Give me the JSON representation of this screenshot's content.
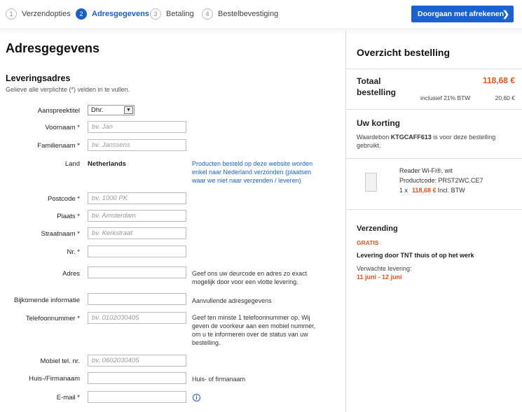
{
  "steps": [
    {
      "num": "1",
      "label": "Verzendopties"
    },
    {
      "num": "2",
      "label": "Adresgegevens"
    },
    {
      "num": "3",
      "label": "Betaling"
    },
    {
      "num": "4",
      "label": "Bestelbevestiging"
    }
  ],
  "header": {
    "checkout_label": "Doorgaan met afrekenen",
    "checkout_icon": "chevron-right-icon"
  },
  "form": {
    "title": "Adresgegevens",
    "section_title": "Leveringsadres",
    "section_note": "Gelieve alle verplichte (*) velden in te vullen.",
    "salutation": {
      "label": "Aanspreektitel",
      "value": "Dhr."
    },
    "first_name": {
      "label": "Voornaam *",
      "placeholder": "bv. Jan"
    },
    "last_name": {
      "label": "Familienaam *",
      "placeholder": "bv. Janssens"
    },
    "country": {
      "label": "Land",
      "value": "Netherlands",
      "note": "Producten besteld op deze website worden enkel naar Nederland verzonden (plaatsen waar we niet naar verzenden / leveren)"
    },
    "postcode": {
      "label": "Postcode *",
      "placeholder": "bv. 1000 PK"
    },
    "city": {
      "label": "Plaats *",
      "placeholder": "bv. Amsterdam"
    },
    "street": {
      "label": "Straatnaam *",
      "placeholder": "bv. Kerkstraat"
    },
    "number": {
      "label": "Nr. *",
      "placeholder": ""
    },
    "address": {
      "label": "Adres",
      "placeholder": "",
      "hint": "Geef ons uw deurcode en adres zo exact mogelijk door voor een vlotte levering."
    },
    "extra": {
      "label": "Bijkomende informatie",
      "placeholder": "",
      "hint": "Aanvullende adresgegevens"
    },
    "phone": {
      "label": "Telefoonnummer *",
      "placeholder": "bv. 0102030405",
      "hint": "Geef ten minste 1 telefoonnummer op. Wij geven de voorkeur aan een mobiel nummer, om u te informeren over de status van uw bestelling."
    },
    "mobile": {
      "label": "Mobiel tel. nr.",
      "placeholder": "bv. 0602030405"
    },
    "company": {
      "label": "Huis-/Firmanaam",
      "placeholder": "",
      "hint": "Huis- of firmanaam"
    },
    "email": {
      "label": "E-mail *",
      "placeholder": "",
      "icon": "info-icon"
    }
  },
  "summary": {
    "title": "Overzicht bestelling",
    "total_label": "Totaal bestelling",
    "total_value": "118,68 €",
    "vat_label": "inclusief 21% BTW",
    "vat_value": "20,60 €",
    "discount_title": "Uw korting",
    "discount_pre": "Waardebon ",
    "discount_code": "KTGCAFF613",
    "discount_post": " is voor deze bestelling gebruikt.",
    "product": {
      "name": "Reader Wi-Fi®, wit",
      "code": "Productcode: PRST2WC.CE7",
      "qty": "1 x",
      "price": "118,68 €",
      "price_suffix": "Incl. BTW"
    },
    "shipping_title": "Verzending",
    "shipping_free": "GRATIS",
    "shipping_method": "Levering door TNT thuis of op het werk",
    "expected_label": "Verwachte levering:",
    "expected_dates": "11 juni - 12 juni"
  },
  "colors": {
    "accent": "#1a62d0",
    "price": "#e8541c"
  }
}
